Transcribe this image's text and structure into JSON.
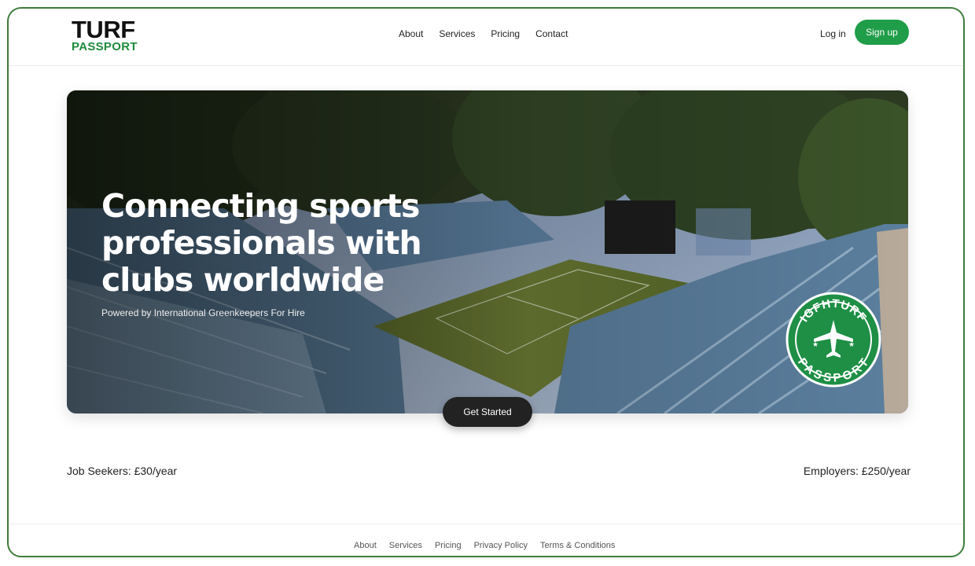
{
  "brand": {
    "line1": "TURF",
    "line2": "PASSPORT",
    "accent": "#1f9d48"
  },
  "nav": {
    "items": [
      "About",
      "Services",
      "Pricing",
      "Contact"
    ]
  },
  "auth": {
    "login": "Log in",
    "signup": "Sign up"
  },
  "hero": {
    "title_lines": [
      "Connecting sports",
      "professionals with",
      "clubs worldwide"
    ],
    "subtitle": "Powered by International Greenkeepers For Hire",
    "badge": {
      "top": "IGFHTURF",
      "bottom": "PASSPORT",
      "icon": "airplane-icon"
    },
    "cta": "Get Started"
  },
  "pricing": {
    "job_seekers": "Job Seekers: £30/year",
    "employers": "Employers: £250/year"
  },
  "footer": {
    "links": [
      "About",
      "Services",
      "Pricing",
      "Privacy Policy",
      "Terms & Conditions"
    ]
  }
}
